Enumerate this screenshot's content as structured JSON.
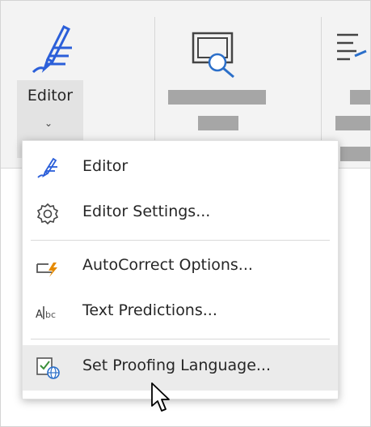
{
  "ribbon": {
    "editor_button": {
      "label": "Editor",
      "dropdown_glyph": "⌄",
      "icon": "editor-pen-icon"
    },
    "other_buttons": [
      {
        "icon": "screen-search-icon"
      },
      {
        "icon": "document-lines-icon"
      }
    ]
  },
  "menu": {
    "items": [
      {
        "label": "Editor",
        "icon": "editor-pen-icon"
      },
      {
        "label": "Editor Settings...",
        "icon": "gear-icon"
      },
      {
        "label": "AutoCorrect Options...",
        "icon": "autocorrect-icon"
      },
      {
        "label": "Text Predictions...",
        "icon": "text-predictions-icon"
      },
      {
        "label": "Set Proofing Language...",
        "icon": "proofing-language-icon",
        "highlighted": true
      }
    ]
  },
  "colors": {
    "accent_blue": "#2b5fd9",
    "autocorrect_orange": "#e58a00",
    "ribbon_bg": "#f3f3f3",
    "hover_bg": "#ebebeb"
  }
}
